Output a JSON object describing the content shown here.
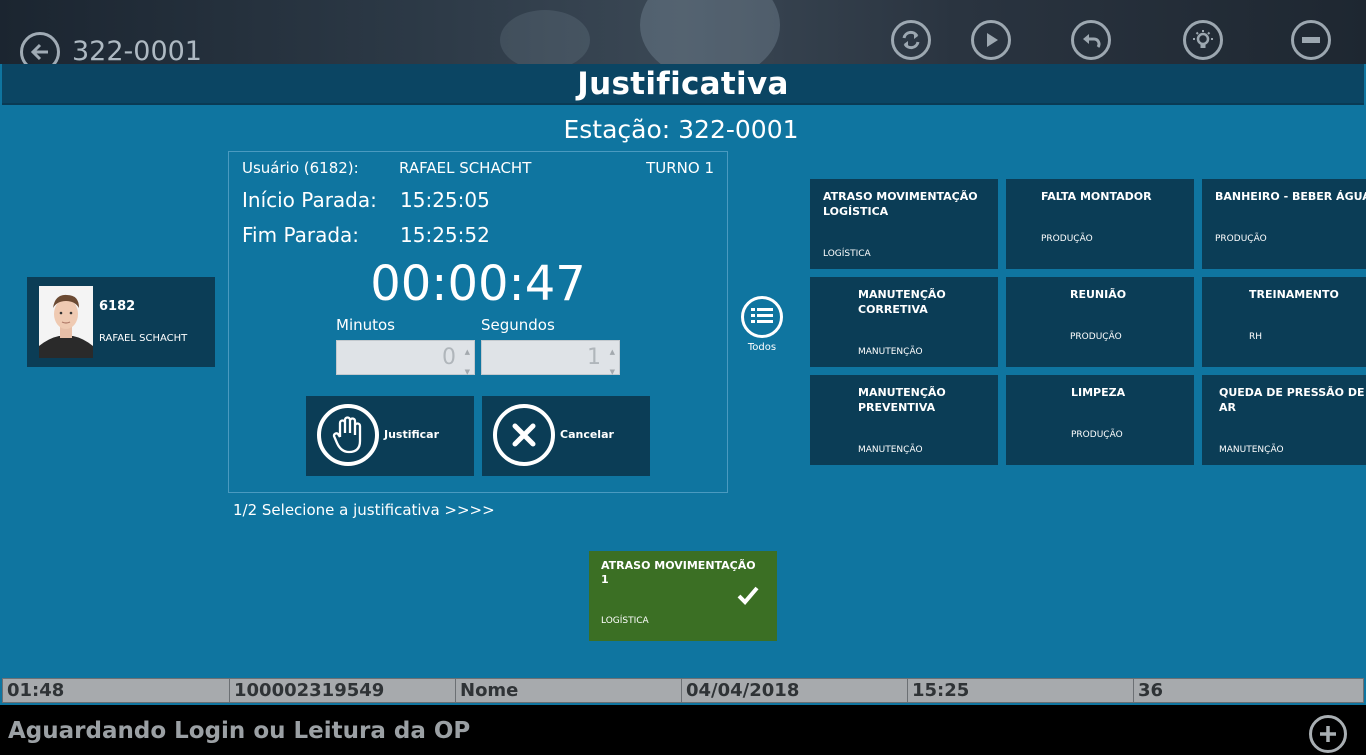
{
  "topbar": {
    "station_code": "322-0001"
  },
  "header": {
    "title": "Justificativa",
    "station": "Estação: 322-0001"
  },
  "operator": {
    "id": "6182",
    "name": "RAFAEL SCHACHT"
  },
  "panel": {
    "user_label": "Usuário (6182):",
    "user_name": "RAFAEL SCHACHT",
    "turno": "TURNO 1",
    "inicio_label": "Início Parada:",
    "inicio_value": "15:25:05",
    "fim_label": "Fim Parada:",
    "fim_value": "15:25:52",
    "timer": "00:00:47",
    "minutes_label": "Minutos",
    "minutes_value": "0",
    "seconds_label": "Segundos",
    "seconds_value": "1",
    "justify_label": "Justificar",
    "cancel_label": "Cancelar"
  },
  "status_line": "1/2   Selecione a justificativa >>>>",
  "todos_label": "Todos",
  "reasons": [
    {
      "title": "ATRASO MOVIMENTAÇÃO LOGÍSTICA",
      "category": "LOGÍSTICA"
    },
    {
      "title": "FALTA MONTADOR",
      "category": "PRODUÇÃO"
    },
    {
      "title": "BANHEIRO - BEBER ÁGUA",
      "category": "PRODUÇÃO"
    },
    {
      "title": "MANUTENÇÃO CORRETIVA",
      "category": "MANUTENÇÃO"
    },
    {
      "title": "REUNIÃO",
      "category": "PRODUÇÃO"
    },
    {
      "title": "TREINAMENTO",
      "category": "RH"
    },
    {
      "title": "MANUTENÇÃO PREVENTIVA",
      "category": "MANUTENÇÃO"
    },
    {
      "title": "LIMPEZA",
      "category": "PRODUÇÃO"
    },
    {
      "title": "QUEDA DE PRESSÃO DE AR",
      "category": "MANUTENÇÃO"
    }
  ],
  "selected": {
    "title": "ATRASO MOVIMENTAÇÃO",
    "count": "1",
    "category": "LOGÍSTICA"
  },
  "infobar": [
    "01:48",
    "100002319549",
    "Nome",
    "04/04/2018",
    "15:25",
    "36"
  ],
  "statusbar": {
    "message": "Aguardando Login ou Leitura da OP"
  },
  "colors": {
    "background": "#0f75a0",
    "tile": "#0b3d56",
    "selected": "#3b6f24",
    "header": "#0b4563"
  },
  "icons": [
    "back-arrow-icon",
    "sync-icon",
    "play-icon",
    "undo-icon",
    "lightbulb-icon",
    "minus-icon",
    "hand-icon",
    "close-icon",
    "list-icon",
    "check-icon",
    "plus-icon"
  ]
}
